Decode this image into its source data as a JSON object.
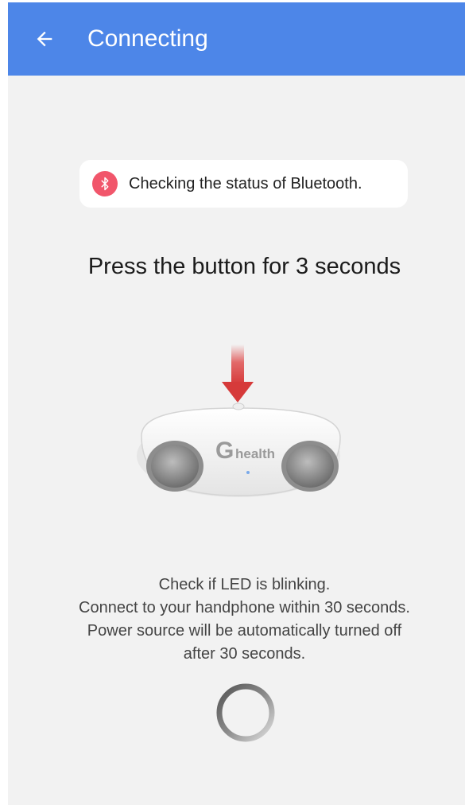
{
  "appbar": {
    "title": "Connecting",
    "back_icon": "arrow-left-icon",
    "color": "#4d86e8"
  },
  "bluetooth_status": {
    "icon": "bluetooth-icon",
    "icon_color": "#f1566b",
    "text": "Checking the status of Bluetooth."
  },
  "instruction_heading": "Press the button for 3 seconds",
  "device": {
    "brand_mark": "G",
    "brand_text": "health",
    "arrow_color": "#d63a3a"
  },
  "instructions": {
    "line1": "Check if LED is blinking.",
    "line2": "Connect to your handphone within 30 seconds.",
    "line3": "Power source will be automatically turned off",
    "line4": "after 30 seconds."
  },
  "loading": {
    "icon": "loading-spinner-icon"
  }
}
